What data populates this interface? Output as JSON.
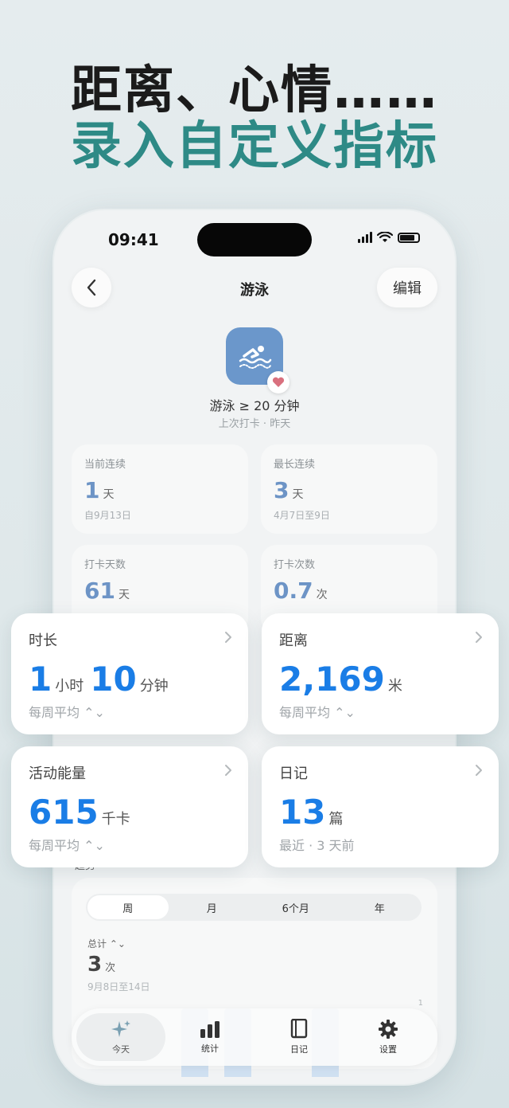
{
  "headline": {
    "line1": "距离、心情……",
    "line2": "录入自定义指标"
  },
  "status": {
    "time": "09:41"
  },
  "nav": {
    "title": "游泳",
    "edit_label": "编辑"
  },
  "habit": {
    "name": "游泳 ≥ 20 分钟",
    "last": "上次打卡 · 昨天",
    "icon": "swimmer-icon"
  },
  "stats": [
    {
      "label": "当前连续",
      "value": "1",
      "unit": "天",
      "foot": "自9月13日"
    },
    {
      "label": "最长连续",
      "value": "3",
      "unit": "天",
      "foot": "4月7日至9日"
    },
    {
      "label": "打卡天数",
      "value": "61",
      "unit": "天",
      "foot": ""
    },
    {
      "label": "打卡次数",
      "value": "0.7",
      "unit": "次",
      "foot": ""
    }
  ],
  "metrics": [
    {
      "label": "时长",
      "v1": "1",
      "u1": "小时",
      "v2": "10",
      "u2": "分钟",
      "foot": "每周平均 ⌃⌄"
    },
    {
      "label": "距离",
      "v1": "2,169",
      "u1": "米",
      "foot": "每周平均 ⌃⌄"
    },
    {
      "label": "活动能量",
      "v1": "615",
      "u1": "千卡",
      "foot": "每周平均 ⌃⌄"
    },
    {
      "label": "日记",
      "v1": "13",
      "u1": "篇",
      "foot": "最近 · 3 天前"
    }
  ],
  "trend": {
    "label": "趋势",
    "segments": [
      "周",
      "月",
      "6个月",
      "年"
    ],
    "active_segment": 0,
    "total_label": "总计 ⌃⌄",
    "total_value": "3",
    "total_unit": "次",
    "range": "9月8日至14日",
    "axis_max": "1",
    "bars": [
      1,
      1,
      0,
      1
    ]
  },
  "tabs": [
    {
      "label": "今天",
      "icon": "sparkle-icon"
    },
    {
      "label": "统计",
      "icon": "bar-chart-icon"
    },
    {
      "label": "日记",
      "icon": "book-icon"
    },
    {
      "label": "设置",
      "icon": "gear-icon"
    }
  ],
  "colors": {
    "accent_blue": "#1a7de6",
    "soft_blue": "#6d94c6",
    "teal": "#2e8a86",
    "icon_bg": "#6b97cb",
    "heart": "#d9707e"
  }
}
